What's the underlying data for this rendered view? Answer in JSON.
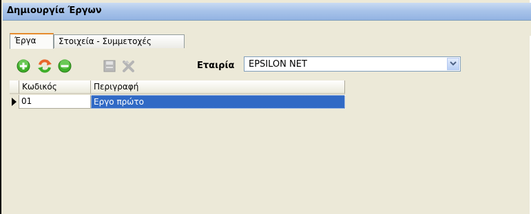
{
  "window": {
    "title": "Δημιουργία Έργων"
  },
  "tabs": [
    {
      "label": "Έργα",
      "active": true
    },
    {
      "label": "Στοιχεία - Συμμετοχές",
      "active": false
    }
  ],
  "toolbar": {
    "buttons": [
      {
        "icon": "add-icon",
        "color": "#3fae2a"
      },
      {
        "icon": "refresh-icon",
        "color": "#e8662a"
      },
      {
        "icon": "remove-icon",
        "color": "#3fae2a"
      },
      {
        "icon": "save-icon",
        "disabled": true
      },
      {
        "icon": "delete-icon",
        "disabled": true
      }
    ],
    "company_label": "Εταιρία",
    "company_value": "EPSILON NET"
  },
  "grid": {
    "columns": [
      "Κωδικός",
      "Περιγραφή"
    ],
    "rows": [
      {
        "code": "01",
        "description": "Εργο πρώτο",
        "selected": true
      }
    ]
  },
  "colors": {
    "selection": "#316ac5",
    "titlebar": "#a9c4ea",
    "background": "#ece9d8"
  }
}
